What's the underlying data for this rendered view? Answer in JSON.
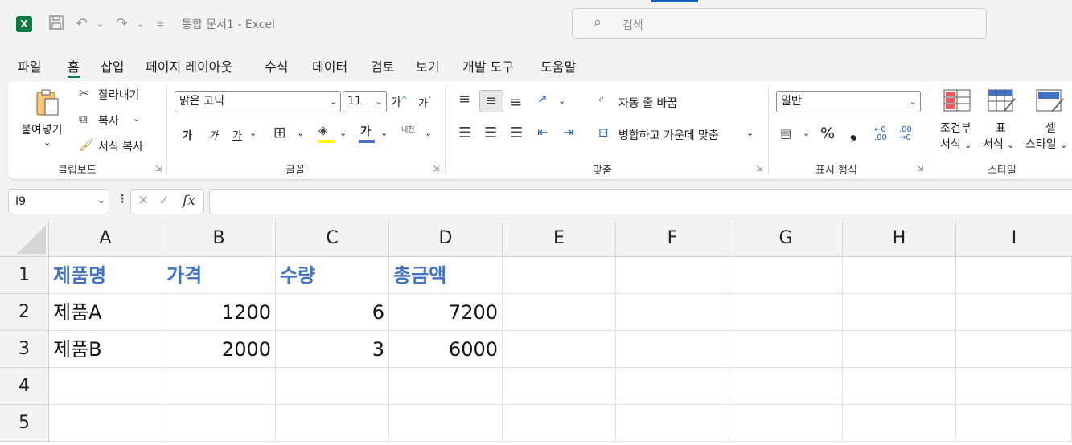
{
  "window": {
    "title": "통합 문서1  -  Excel",
    "search_placeholder": "검색",
    "logo": "X"
  },
  "menu": [
    "파일",
    "홈",
    "삽입",
    "페이지 레이아웃",
    "수식",
    "데이터",
    "검토",
    "보기",
    "개발 도구",
    "도움말"
  ],
  "ribbon": {
    "clipboard": {
      "paste": "붙여넣기",
      "cut": "잘라내기",
      "copy": "복사",
      "format_painter": "서식 복사",
      "label": "클립보드"
    },
    "font": {
      "name": "맑은 고딕",
      "size": "11",
      "grow": "가",
      "shrink": "가",
      "bold": "가",
      "italic": "가",
      "underline": "가",
      "font_color": "가",
      "phonetic": "내천",
      "label": "글꼴",
      "fill_color": "#ffff00",
      "text_color": "#4472c4"
    },
    "alignment": {
      "wrap_text": "자동 줄 바꿈",
      "merge_center": "병합하고 가운데 맞춤",
      "label": "맞춤"
    },
    "number": {
      "format": "일반",
      "label": "표시 형식",
      "percent": "%",
      "comma": "❟",
      "inc_decimal": "←0 .00",
      "dec_decimal": ".00 →0"
    },
    "styles": {
      "conditional": [
        "조건부",
        "서식"
      ],
      "table": [
        "표",
        "서식"
      ],
      "cell": [
        "셀",
        "스타일"
      ],
      "label": "스타일"
    }
  },
  "formula_bar": {
    "name_box": "I9",
    "fx": "fx",
    "value": ""
  },
  "sheet": {
    "columns": [
      "A",
      "B",
      "C",
      "D",
      "E",
      "F",
      "G",
      "H",
      "I"
    ],
    "rows": [
      "1",
      "2",
      "3",
      "4",
      "5"
    ],
    "header_color": "#4472c4",
    "cells": [
      [
        "제품명",
        "가격",
        "수량",
        "총금액"
      ],
      [
        "제품A",
        "1200",
        "6",
        "7200"
      ],
      [
        "제품B",
        "2000",
        "3",
        "6000"
      ]
    ]
  }
}
